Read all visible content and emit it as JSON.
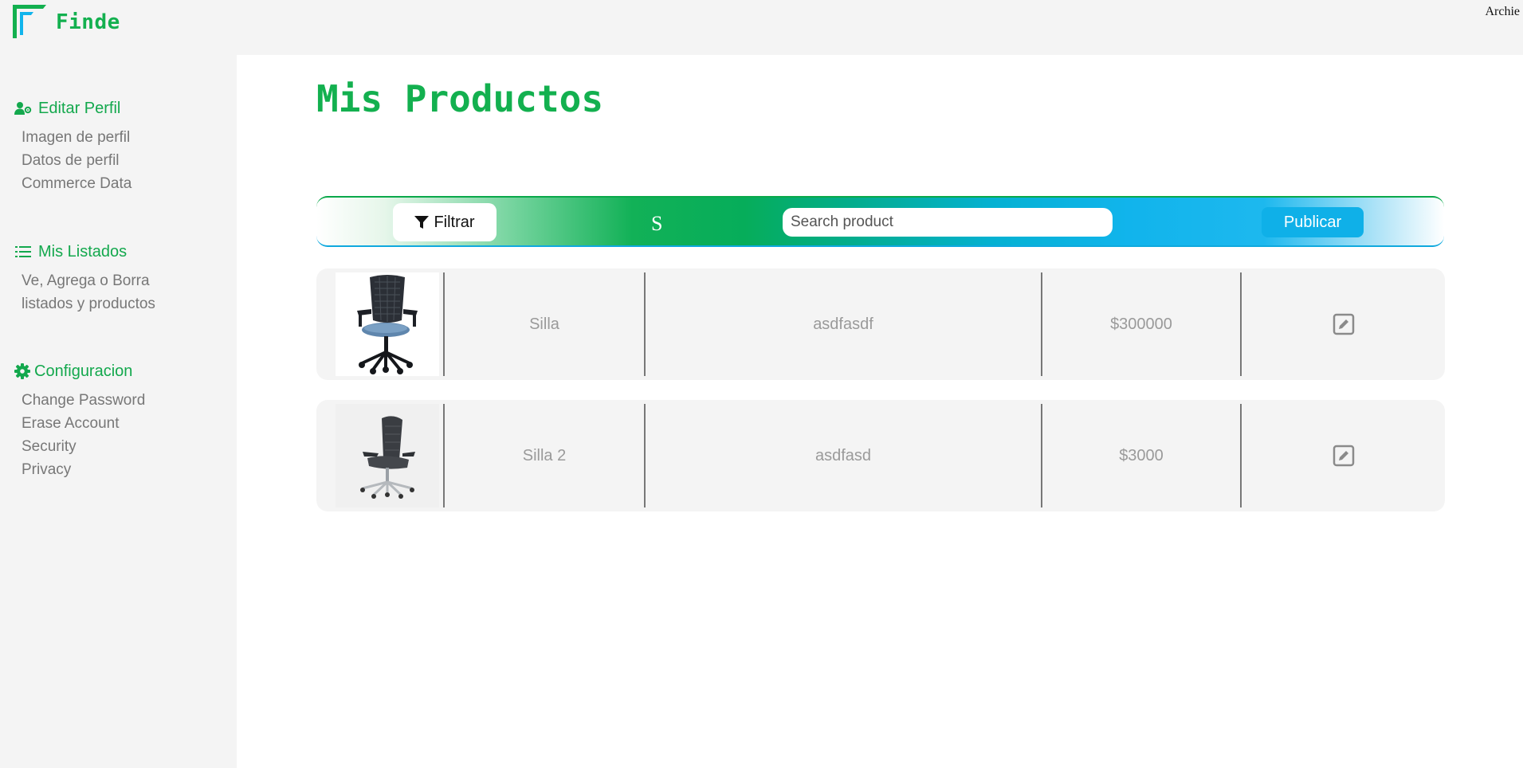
{
  "app": {
    "logo_text": "Finde",
    "user_name": "Archie"
  },
  "sidebar": {
    "sections": [
      {
        "title": "Editar Perfil",
        "icon": "user-gear-icon",
        "items": [
          "Imagen de perfil",
          "Datos de perfil",
          "Commerce Data"
        ]
      },
      {
        "title": "Mis Listados",
        "icon": "list-icon",
        "items": [
          "Ve, Agrega o Borra",
          "listados y productos"
        ]
      },
      {
        "title": "Configuracion",
        "icon": "gear-icon",
        "items": [
          "Change Password",
          "Erase Account",
          "Security",
          "Privacy"
        ]
      }
    ]
  },
  "main": {
    "title": "Mis Productos",
    "toolbar": {
      "filter_label": "Filtrar",
      "center_letter": "S",
      "search_placeholder": "Search product",
      "publish_label": "Publicar"
    },
    "products": [
      {
        "name": "Silla",
        "description": "asdfasdf",
        "price": "$300000",
        "image": "office-chair-blue-seat"
      },
      {
        "name": "Silla 2",
        "description": "asdfasd",
        "price": "$3000",
        "image": "office-chair-gray-ergonomic"
      }
    ]
  },
  "colors": {
    "brand_green": "#13b04f",
    "brand_blue": "#0fb0e8",
    "muted_text": "#9a9a9a"
  }
}
